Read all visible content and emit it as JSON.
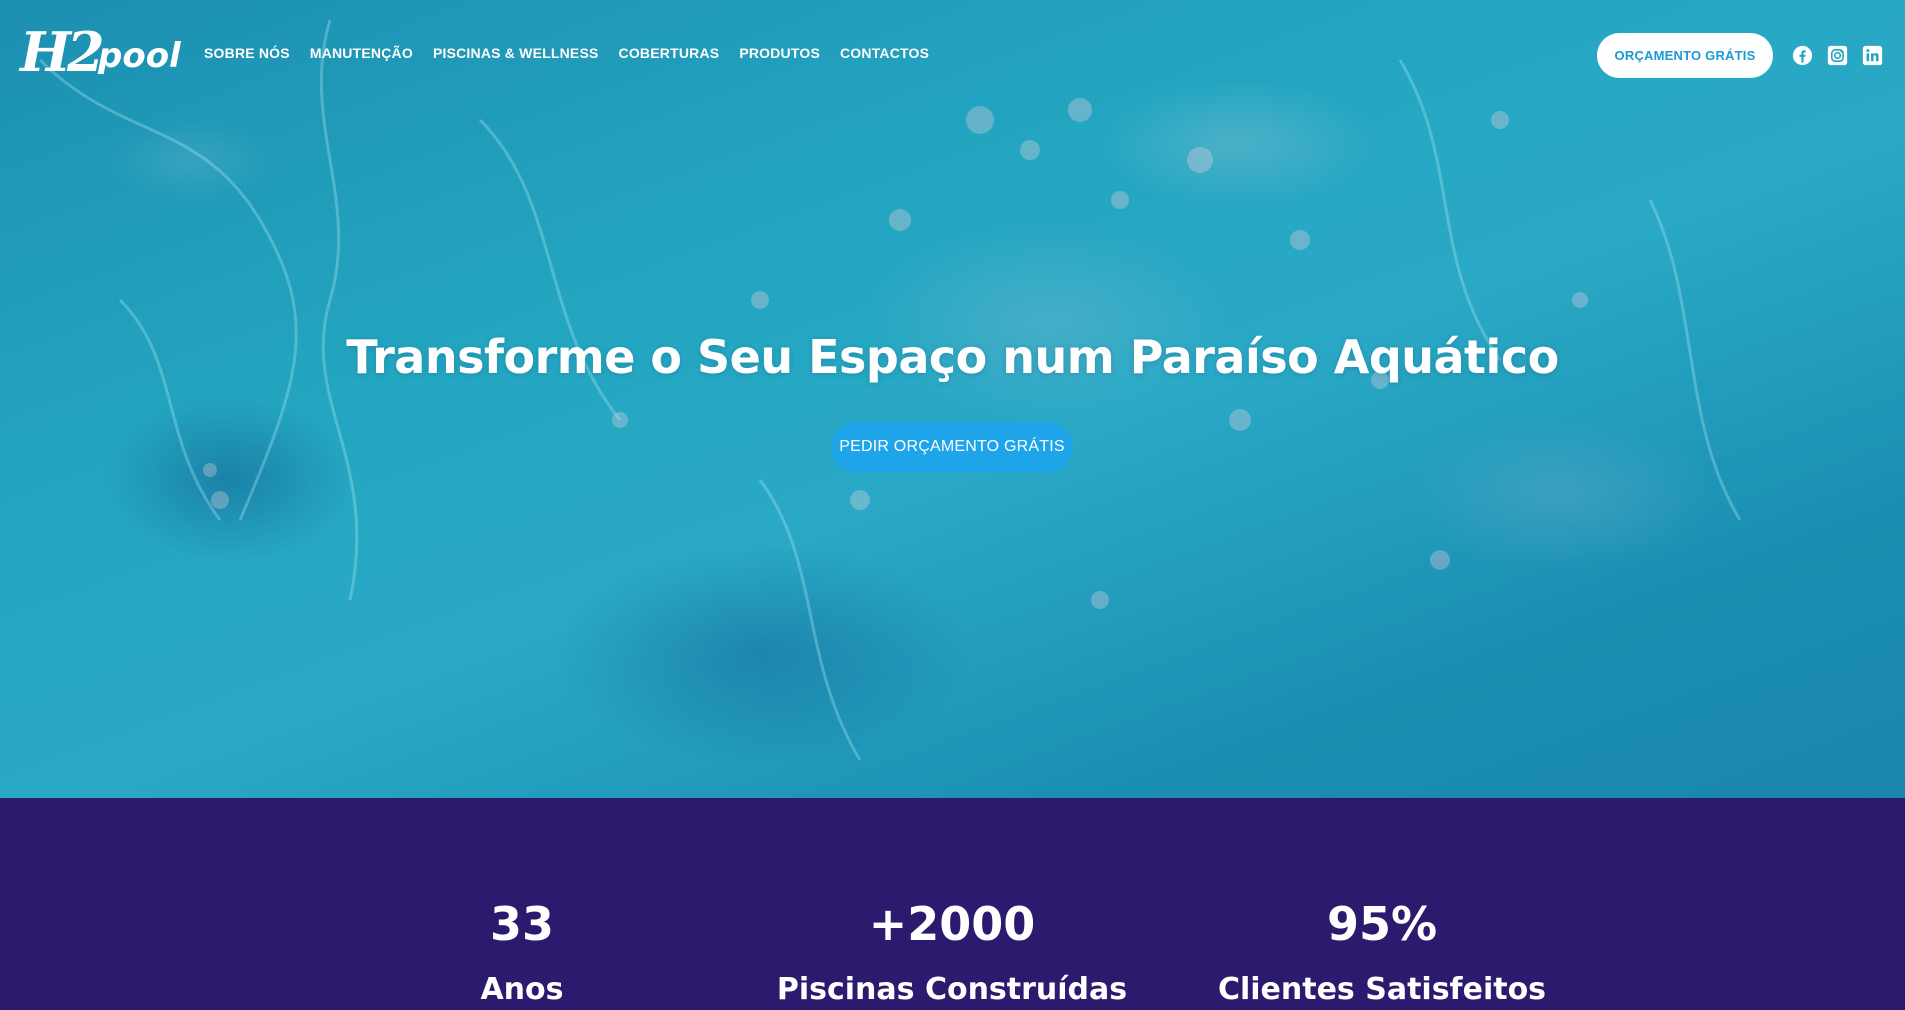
{
  "brand": {
    "logo_main": "H2",
    "logo_sub": "pool"
  },
  "nav": {
    "items": [
      {
        "label": "SOBRE NÓS"
      },
      {
        "label": "MANUTENÇÃO"
      },
      {
        "label": "PISCINAS & WELLNESS"
      },
      {
        "label": "COBERTURAS"
      },
      {
        "label": "PRODUTOS"
      },
      {
        "label": "CONTACTOS"
      }
    ]
  },
  "header": {
    "cta_label": "ORÇAMENTO GRÁTIS"
  },
  "socials": [
    {
      "icon": "facebook-icon"
    },
    {
      "icon": "instagram-icon"
    },
    {
      "icon": "linkedin-icon"
    }
  ],
  "hero": {
    "headline": "Transforme o Seu Espaço num Paraíso Aquático",
    "cta_label": "PEDIR ORÇAMENTO GRÁTIS"
  },
  "stats": [
    {
      "value": "33",
      "label": "Anos"
    },
    {
      "value": "+2000",
      "label": "Piscinas Construídas"
    },
    {
      "value": "95%",
      "label": "Clientes Satisfeitos"
    }
  ],
  "colors": {
    "water": "#23a6c1",
    "stats_bg": "#2c1a6e",
    "cta_blue": "#1ea4e9",
    "cta_top_text": "#1a9ad7",
    "white": "#ffffff"
  }
}
